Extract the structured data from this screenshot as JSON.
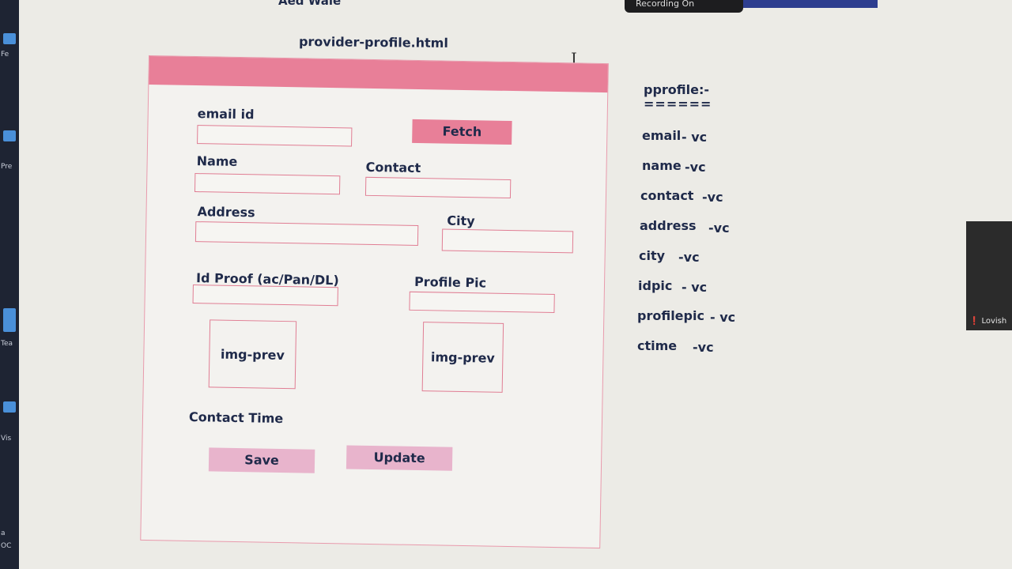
{
  "chrome": {
    "app_title": "Aed Wale",
    "recording": "Recording On",
    "participant": "Lovish",
    "taskbar_labels": [
      "Fe",
      "Pre",
      "Tea",
      "Vis",
      "a",
      "OC"
    ]
  },
  "editor": {
    "file_title": "provider-profile.html"
  },
  "form": {
    "email_label": "email id",
    "fetch_label": "Fetch",
    "name_label": "Name",
    "contact_label": "Contact",
    "address_label": "Address",
    "city_label": "City",
    "idproof_label": "Id Proof  (ac/Pan/DL)",
    "profilepic_label": "Profile Pic",
    "idproof_preview": "img-prev",
    "profilepic_preview": "img-prev",
    "contact_time_label": "Contact Time",
    "save_label": "Save",
    "update_label": "Update"
  },
  "notes": {
    "heading": "pprofile:-",
    "underline": "======",
    "fields": [
      {
        "name": "email",
        "type": "- vc"
      },
      {
        "name": "name",
        "type": "-vc"
      },
      {
        "name": "contact",
        "type": "-vc"
      },
      {
        "name": "address",
        "type": "-vc"
      },
      {
        "name": "city",
        "type": "-vc"
      },
      {
        "name": "idpic",
        "type": "- vc"
      },
      {
        "name": "profilepic",
        "type": "- vc"
      },
      {
        "name": "ctime",
        "type": "-vc"
      }
    ]
  },
  "colors": {
    "header_pink": "#e87f98",
    "button_pink": "#e8b4cc",
    "border_pink": "#e07d93",
    "text_navy": "#1f2a4a"
  }
}
